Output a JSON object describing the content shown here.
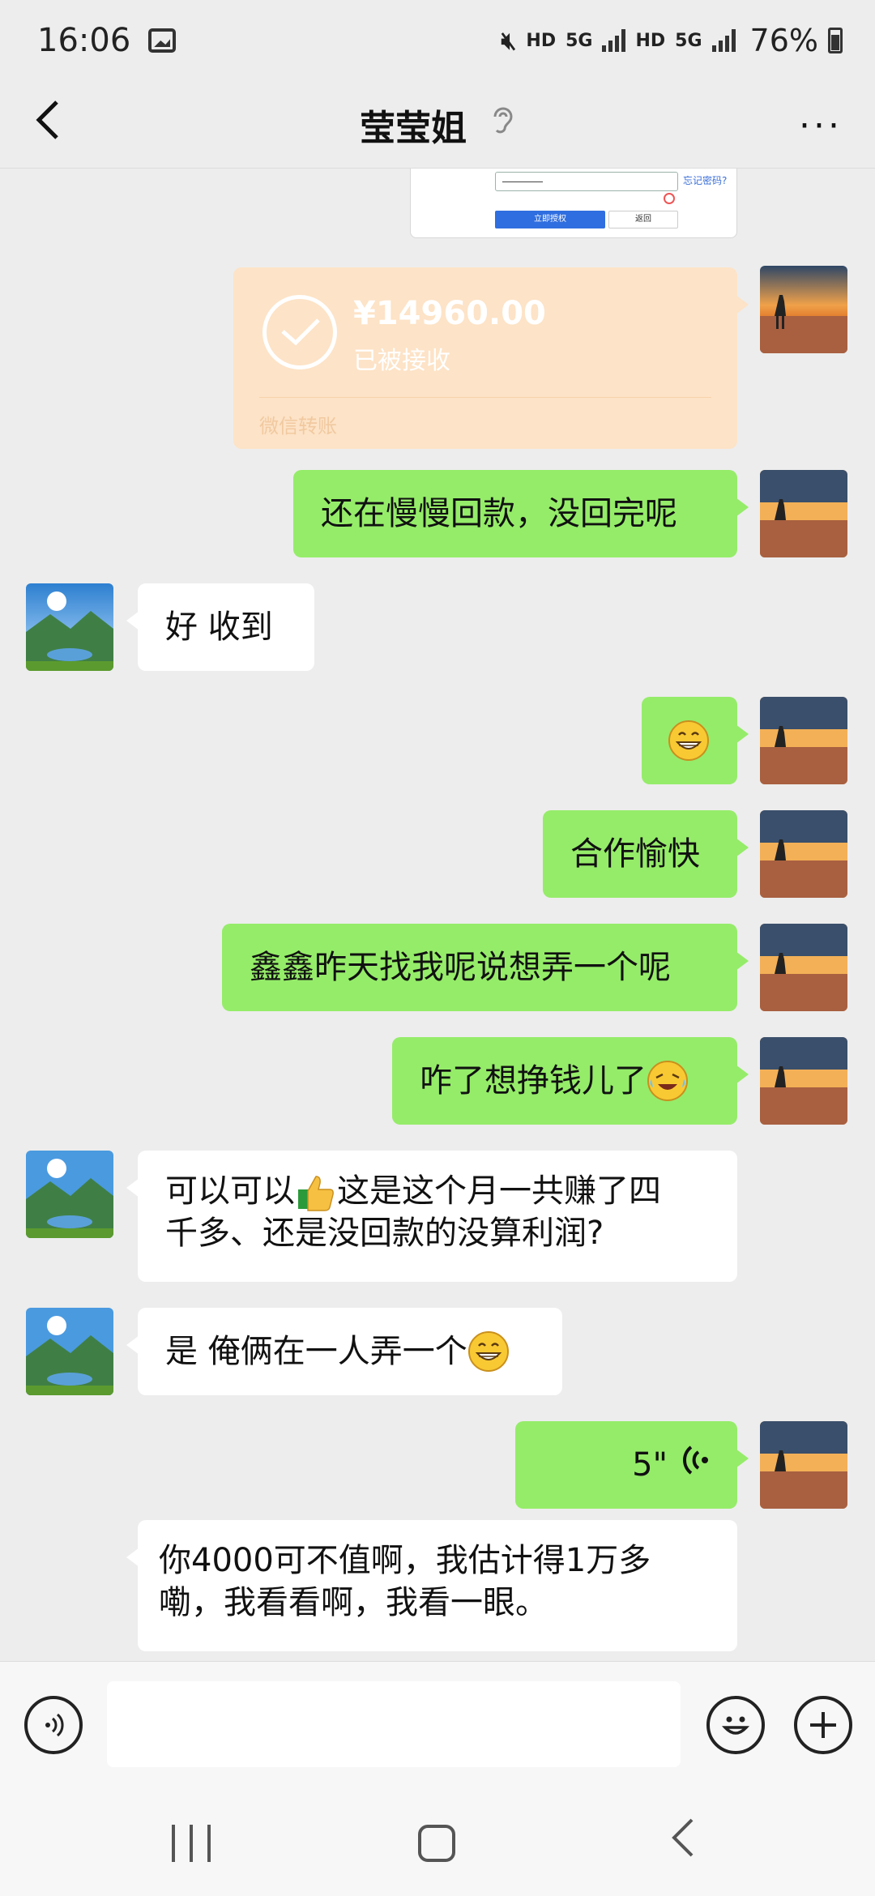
{
  "status_bar": {
    "time": "16:06",
    "network_labels": [
      "HD",
      "5G",
      "HD",
      "5G"
    ],
    "battery": "76%"
  },
  "header": {
    "title": "莹莹姐",
    "back_icon": "chevron-left-icon",
    "ear_icon": "ear-icon",
    "more_label": "···"
  },
  "screenshot_card": {
    "link": "忘记密码?",
    "primary_button": "立即授权",
    "secondary_button": "返回"
  },
  "transfer": {
    "amount": "¥14960.00",
    "status": "已被接收",
    "label": "微信转账"
  },
  "messages": [
    {
      "side": "sent",
      "text": "还在慢慢回款，没回完呢"
    },
    {
      "side": "recv",
      "text": "好 收到"
    },
    {
      "side": "sent",
      "text": "",
      "emoji": "grinning-face"
    },
    {
      "side": "sent",
      "text": "合作愉快"
    },
    {
      "side": "sent",
      "text": "鑫鑫昨天找我呢说想弄一个呢"
    },
    {
      "side": "sent",
      "text": "咋了想挣钱儿了",
      "emoji": "rolling-laughing-face"
    },
    {
      "side": "recv",
      "text_before": "可以可以",
      "emoji": "thumbs-up",
      "text_line1": "这是这个月一共赚了四",
      "text_line2": "千多、还是没回款的没算利润?"
    },
    {
      "side": "recv",
      "text": "是 俺俩在一人弄一个",
      "emoji": "grinning-face"
    },
    {
      "side": "sent",
      "voice_duration": "5\""
    },
    {
      "side": "recv",
      "text_line1": "你4000可不值啊，我估计得1万多",
      "text_line2": "嘞，我看看啊，我看一眼。"
    }
  ],
  "input_bar": {
    "placeholder": "",
    "voice_icon": "voice-icon",
    "emoji_icon": "emoji-icon",
    "plus_icon": "plus-icon"
  },
  "colors": {
    "background": "#ededed",
    "sent_bubble": "#95ec69",
    "recv_bubble": "#ffffff",
    "transfer_bubble": "#fde3c7"
  }
}
